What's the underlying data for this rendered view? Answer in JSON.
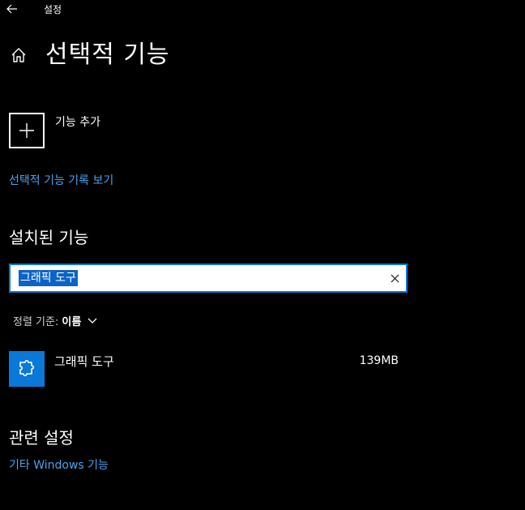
{
  "window": {
    "title": "설정",
    "back_icon": "back-arrow-icon"
  },
  "header": {
    "home_icon": "home-icon",
    "title": "선택적 기능"
  },
  "add_feature": {
    "icon": "plus-icon",
    "label": "기능 추가"
  },
  "history_link": "선택적 기능 기록 보기",
  "installed": {
    "section_title": "설치된 기능",
    "search": {
      "value": "그래픽 도구",
      "clear_icon": "close-icon"
    },
    "sort": {
      "label": "정렬 기준:",
      "value": "이름",
      "chevron_icon": "chevron-down-icon"
    },
    "features": [
      {
        "name": "그래픽 도구",
        "size": "139MB",
        "icon": "puzzle-icon"
      }
    ]
  },
  "related": {
    "section_title": "관련 설정",
    "link": "기타 Windows 기능"
  },
  "colors": {
    "background": "#000000",
    "accent": "#0a78d7",
    "link": "#4aa3ef",
    "selection": "#0a64c8"
  }
}
